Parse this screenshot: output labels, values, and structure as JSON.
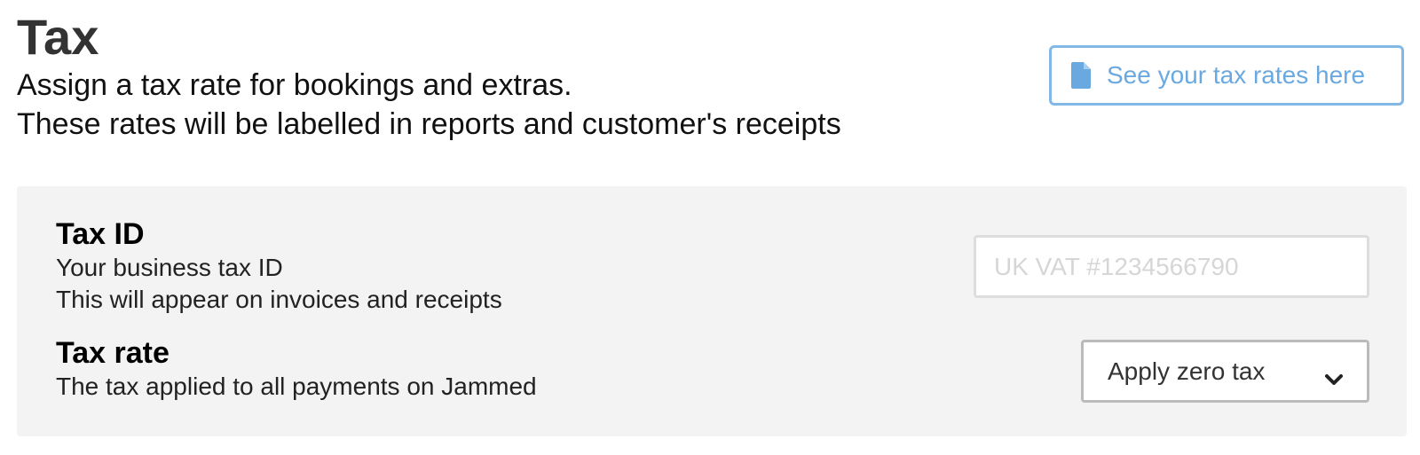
{
  "header": {
    "title": "Tax",
    "description_line1": "Assign a tax rate for bookings and extras.",
    "description_line2": "These rates will be labelled in reports and customer's receipts",
    "tax_rates_button_label": "See your tax rates here",
    "tax_rates_button_icon": "document-icon"
  },
  "tax_id": {
    "title": "Tax ID",
    "description_line1": "Your business tax ID",
    "description_line2": "This will appear on invoices and receipts",
    "input_value": "",
    "input_placeholder": "UK VAT #1234566790"
  },
  "tax_rate": {
    "title": "Tax rate",
    "description": "The tax applied to all payments on Jammed",
    "selected_option": "Apply zero tax",
    "select_icon": "chevron-down-icon"
  },
  "colors": {
    "accent": "#6aa9e0",
    "panel_background": "#f3f3f3",
    "title_text": "#333333"
  }
}
